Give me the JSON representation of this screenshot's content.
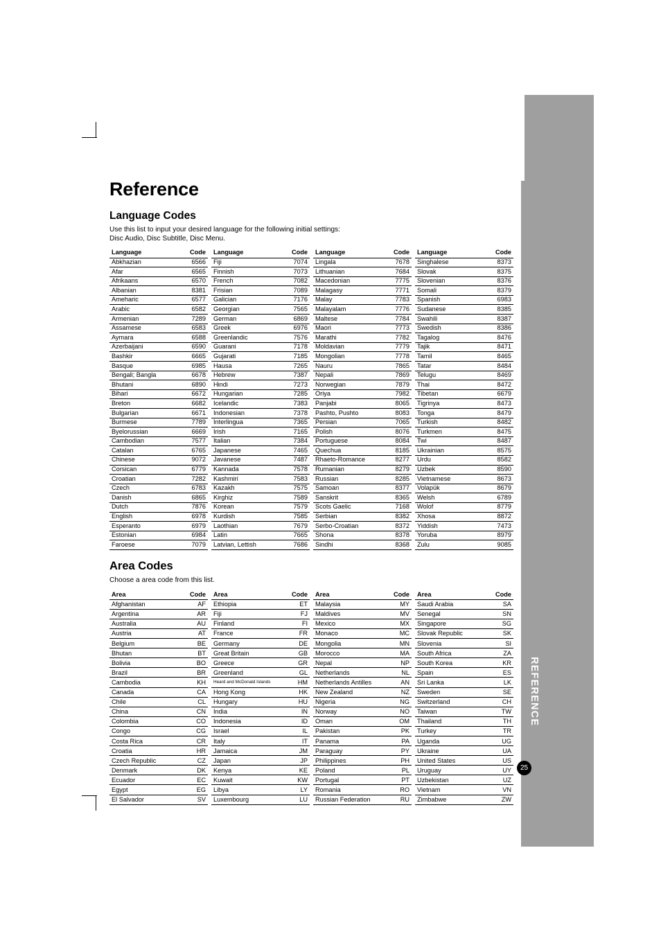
{
  "page": {
    "title": "Reference",
    "page_number": "25",
    "side_label": "REFERENCE"
  },
  "language_section": {
    "title": "Language Codes",
    "intro_line1": "Use this list to input your desired language for the following initial settings:",
    "intro_line2": "Disc Audio, Disc Subtitle, Disc Menu.",
    "headers": [
      "Language",
      "Code"
    ],
    "columns": [
      [
        [
          "Abkhazian",
          "6566"
        ],
        [
          "Afar",
          "6565"
        ],
        [
          "Afrikaans",
          "6570"
        ],
        [
          "Albanian",
          "8381"
        ],
        [
          "Ameharic",
          "6577"
        ],
        [
          "Arabic",
          "6582"
        ],
        [
          "Armenian",
          "7289"
        ],
        [
          "Assamese",
          "6583"
        ],
        [
          "Aymara",
          "6588"
        ],
        [
          "Azerbaijani",
          "6590"
        ],
        [
          "Bashkir",
          "6665"
        ],
        [
          "Basque",
          "6985"
        ],
        [
          "Bengali; Bangla",
          "6678"
        ],
        [
          "Bhutani",
          "6890"
        ],
        [
          "Bihari",
          "6672"
        ],
        [
          "Breton",
          "6682"
        ],
        [
          "Bulgarian",
          "6671"
        ],
        [
          "Burmese",
          "7789"
        ],
        [
          "Byelorussian",
          "6669"
        ],
        [
          "Cambodian",
          "7577"
        ],
        [
          "Catalan",
          "6765"
        ],
        [
          "Chinese",
          "9072"
        ],
        [
          "Corsican",
          "6779"
        ],
        [
          "Croatian",
          "7282"
        ],
        [
          "Czech",
          "6783"
        ],
        [
          "Danish",
          "6865"
        ],
        [
          "Dutch",
          "7876"
        ],
        [
          "English",
          "6978"
        ],
        [
          "Esperanto",
          "6979"
        ],
        [
          "Estonian",
          "6984"
        ],
        [
          "Faroese",
          "7079"
        ]
      ],
      [
        [
          "Fiji",
          "7074"
        ],
        [
          "Finnish",
          "7073"
        ],
        [
          "French",
          "7082"
        ],
        [
          "Frisian",
          "7089"
        ],
        [
          "Galician",
          "7176"
        ],
        [
          "Georgian",
          "7565"
        ],
        [
          "German",
          "6869"
        ],
        [
          "Greek",
          "6976"
        ],
        [
          "Greenlandic",
          "7576"
        ],
        [
          "Guarani",
          "7178"
        ],
        [
          "Gujarati",
          "7185"
        ],
        [
          "Hausa",
          "7265"
        ],
        [
          "Hebrew",
          "7387"
        ],
        [
          "Hindi",
          "7273"
        ],
        [
          "Hungarian",
          "7285"
        ],
        [
          "Icelandic",
          "7383"
        ],
        [
          "Indonesian",
          "7378"
        ],
        [
          "Interlingua",
          "7365"
        ],
        [
          "Irish",
          "7165"
        ],
        [
          "Italian",
          "7384"
        ],
        [
          "Japanese",
          "7465"
        ],
        [
          "Javanese",
          "7487"
        ],
        [
          "Kannada",
          "7578"
        ],
        [
          "Kashmiri",
          "7583"
        ],
        [
          "Kazakh",
          "7575"
        ],
        [
          "Kirghiz",
          "7589"
        ],
        [
          "Korean",
          "7579"
        ],
        [
          "Kurdish",
          "7585"
        ],
        [
          "Laothian",
          "7679"
        ],
        [
          "Latin",
          "7665"
        ],
        [
          "Latvian, Lettish",
          "7686"
        ]
      ],
      [
        [
          "Lingala",
          "7678"
        ],
        [
          "Lithuanian",
          "7684"
        ],
        [
          "Macedonian",
          "7775"
        ],
        [
          "Malagasy",
          "7771"
        ],
        [
          "Malay",
          "7783"
        ],
        [
          "Malayalam",
          "7776"
        ],
        [
          "Maltese",
          "7784"
        ],
        [
          "Maori",
          "7773"
        ],
        [
          "Marathi",
          "7782"
        ],
        [
          "Moldavian",
          "7779"
        ],
        [
          "Mongolian",
          "7778"
        ],
        [
          "Nauru",
          "7865"
        ],
        [
          "Nepali",
          "7869"
        ],
        [
          "Norwegian",
          "7879"
        ],
        [
          "Oriya",
          "7982"
        ],
        [
          "Panjabi",
          "8065"
        ],
        [
          "Pashto, Pushto",
          "8083"
        ],
        [
          "Persian",
          "7065"
        ],
        [
          "Polish",
          "8076"
        ],
        [
          "Portuguese",
          "8084"
        ],
        [
          "Quechua",
          "8185"
        ],
        [
          "Rhaeto-Romance",
          "8277"
        ],
        [
          "Rumanian",
          "8279"
        ],
        [
          "Russian",
          "8285"
        ],
        [
          "Samoan",
          "8377"
        ],
        [
          "Sanskrit",
          "8365"
        ],
        [
          "Scots Gaelic",
          "7168"
        ],
        [
          "Serbian",
          "8382"
        ],
        [
          "Serbo-Croatian",
          "8372"
        ],
        [
          "Shona",
          "8378"
        ],
        [
          "Sindhi",
          "8368"
        ]
      ],
      [
        [
          "Singhalese",
          "8373"
        ],
        [
          "Slovak",
          "8375"
        ],
        [
          "Slovenian",
          "8376"
        ],
        [
          "Somali",
          "8379"
        ],
        [
          "Spanish",
          "6983"
        ],
        [
          "Sudanese",
          "8385"
        ],
        [
          "Swahili",
          "8387"
        ],
        [
          "Swedish",
          "8386"
        ],
        [
          "Tagalog",
          "8476"
        ],
        [
          "Tajik",
          "8471"
        ],
        [
          "Tamil",
          "8465"
        ],
        [
          "Tatar",
          "8484"
        ],
        [
          "Telugu",
          "8469"
        ],
        [
          "Thai",
          "8472"
        ],
        [
          "Tibetan",
          "6679"
        ],
        [
          "Tigrinya",
          "8473"
        ],
        [
          "Tonga",
          "8479"
        ],
        [
          "Turkish",
          "8482"
        ],
        [
          "Turkmen",
          "8475"
        ],
        [
          "Twi",
          "8487"
        ],
        [
          "Ukrainian",
          "8575"
        ],
        [
          "Urdu",
          "8582"
        ],
        [
          "Uzbek",
          "8590"
        ],
        [
          "Vietnamese",
          "8673"
        ],
        [
          "Volapük",
          "8679"
        ],
        [
          "Welsh",
          "6789"
        ],
        [
          "Wolof",
          "8779"
        ],
        [
          "Xhosa",
          "8872"
        ],
        [
          "Yiddish",
          "7473"
        ],
        [
          "Yoruba",
          "8979"
        ],
        [
          "Zulu",
          "9085"
        ]
      ]
    ]
  },
  "area_section": {
    "title": "Area Codes",
    "intro": "Choose a area code from this list.",
    "headers": [
      "Area",
      "Code"
    ],
    "columns": [
      [
        [
          "Afghanistan",
          "AF"
        ],
        [
          "Argentina",
          "AR"
        ],
        [
          "Australia",
          "AU"
        ],
        [
          "Austria",
          "AT"
        ],
        [
          "Belgium",
          "BE"
        ],
        [
          "Bhutan",
          "BT"
        ],
        [
          "Bolivia",
          "BO"
        ],
        [
          "Brazil",
          "BR"
        ],
        [
          "Cambodia",
          "KH"
        ],
        [
          "Canada",
          "CA"
        ],
        [
          "Chile",
          "CL"
        ],
        [
          "China",
          "CN"
        ],
        [
          "Colombia",
          "CO"
        ],
        [
          "Congo",
          "CG"
        ],
        [
          "Costa Rica",
          "CR"
        ],
        [
          "Croatia",
          "HR"
        ],
        [
          "Czech Republic",
          "CZ"
        ],
        [
          "Denmark",
          "DK"
        ],
        [
          "Ecuador",
          "EC"
        ],
        [
          "Egypt",
          "EG"
        ],
        [
          "El Salvador",
          "SV"
        ]
      ],
      [
        [
          "Ethiopia",
          "ET"
        ],
        [
          "Fiji",
          "FJ"
        ],
        [
          "Finland",
          "FI"
        ],
        [
          "France",
          "FR"
        ],
        [
          "Germany",
          "DE"
        ],
        [
          "Great Britain",
          "GB"
        ],
        [
          "Greece",
          "GR"
        ],
        [
          "Greenland",
          "GL"
        ],
        [
          "Heard and McDonald Islands",
          "HM"
        ],
        [
          "Hong Kong",
          "HK"
        ],
        [
          "Hungary",
          "HU"
        ],
        [
          "India",
          "IN"
        ],
        [
          "Indonesia",
          "ID"
        ],
        [
          "Israel",
          "IL"
        ],
        [
          "Italy",
          "IT"
        ],
        [
          "Jamaica",
          "JM"
        ],
        [
          "Japan",
          "JP"
        ],
        [
          "Kenya",
          "KE"
        ],
        [
          "Kuwait",
          "KW"
        ],
        [
          "Libya",
          "LY"
        ],
        [
          "Luxembourg",
          "LU"
        ]
      ],
      [
        [
          "Malaysia",
          "MY"
        ],
        [
          "Maldives",
          "MV"
        ],
        [
          "Mexico",
          "MX"
        ],
        [
          "Monaco",
          "MC"
        ],
        [
          "Mongolia",
          "MN"
        ],
        [
          "Morocco",
          "MA"
        ],
        [
          "Nepal",
          "NP"
        ],
        [
          "Netherlands",
          "NL"
        ],
        [
          "Netherlands Antilles",
          "AN"
        ],
        [
          "New Zealand",
          "NZ"
        ],
        [
          "Nigeria",
          "NG"
        ],
        [
          "Norway",
          "NO"
        ],
        [
          "Oman",
          "OM"
        ],
        [
          "Pakistan",
          "PK"
        ],
        [
          "Panama",
          "PA"
        ],
        [
          "Paraguay",
          "PY"
        ],
        [
          "Philippines",
          "PH"
        ],
        [
          "Poland",
          "PL"
        ],
        [
          "Portugal",
          "PT"
        ],
        [
          "Romania",
          "RO"
        ],
        [
          "Russian Federation",
          "RU"
        ]
      ],
      [
        [
          "Saudi Arabia",
          "SA"
        ],
        [
          "Senegal",
          "SN"
        ],
        [
          "Singapore",
          "SG"
        ],
        [
          "Slovak Republic",
          "SK"
        ],
        [
          "Slovenia",
          "SI"
        ],
        [
          "South Africa",
          "ZA"
        ],
        [
          "South Korea",
          "KR"
        ],
        [
          "Spain",
          "ES"
        ],
        [
          "Sri Lanka",
          "LK"
        ],
        [
          "Sweden",
          "SE"
        ],
        [
          "Switzerland",
          "CH"
        ],
        [
          "Taiwan",
          "TW"
        ],
        [
          "Thailand",
          "TH"
        ],
        [
          "Turkey",
          "TR"
        ],
        [
          "Uganda",
          "UG"
        ],
        [
          "Ukraine",
          "UA"
        ],
        [
          "United States",
          "US"
        ],
        [
          "Uruguay",
          "UY"
        ],
        [
          "Uzbekistan",
          "UZ"
        ],
        [
          "Vietnam",
          "VN"
        ],
        [
          "Zimbabwe",
          "ZW"
        ]
      ]
    ]
  }
}
